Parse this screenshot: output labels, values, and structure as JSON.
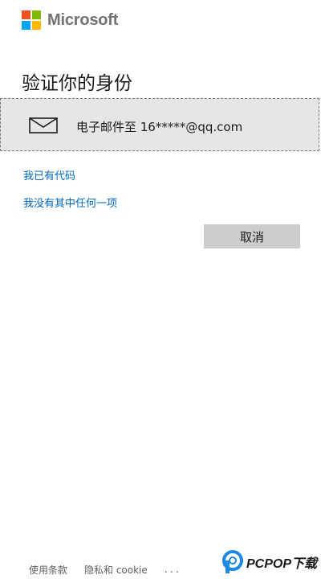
{
  "brand": {
    "name": "Microsoft",
    "logo_colors": [
      "#f25022",
      "#7fba00",
      "#00a4ef",
      "#ffb900"
    ]
  },
  "verify": {
    "title": "验证你的身份",
    "option": {
      "icon": "mail-icon",
      "label": "电子邮件至 16*****@qq.com"
    },
    "links": {
      "have_code": "我已有代码",
      "none_of_these": "我没有其中任何一项"
    },
    "cancel_label": "取消"
  },
  "footer": {
    "terms": "使用条款",
    "privacy": "隐私和 cookie",
    "more": "..."
  },
  "watermark": {
    "text": "PCPOP下载"
  },
  "colors": {
    "link": "#0067b8",
    "option_bg": "#e6e6e6",
    "button_bg": "#cccccc",
    "text": "#1b1b1b",
    "footer_text": "#616161"
  }
}
